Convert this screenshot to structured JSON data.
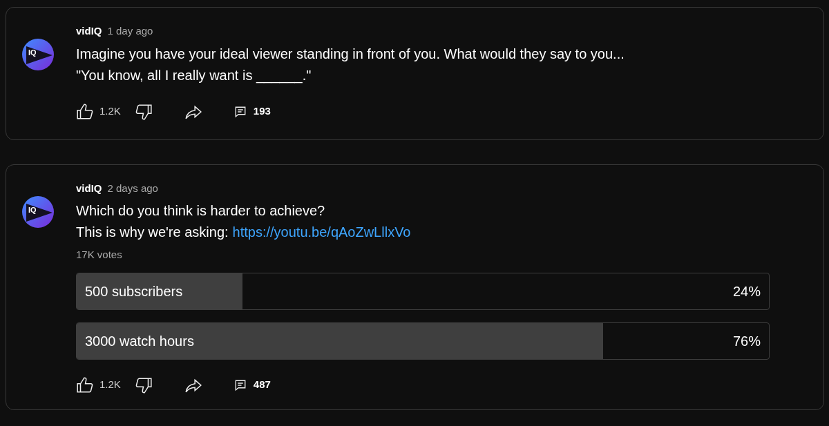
{
  "posts": [
    {
      "kind": "text",
      "avatar_text": "IQ",
      "author": "vidIQ",
      "time": "1 day ago",
      "lines": [
        {
          "text": "Imagine you have your ideal viewer standing in front of you. What would they say to you..."
        },
        {
          "text": "\"You know, all I really want is ______.\""
        }
      ],
      "likes": "1.2K",
      "comments": "193"
    },
    {
      "kind": "poll",
      "avatar_text": "IQ",
      "author": "vidIQ",
      "time": "2 days ago",
      "lines": [
        {
          "text": "Which do you think is harder to achieve?"
        },
        {
          "text": "This is why we're asking:",
          "link": "https://youtu.be/qAoZwLllxVo"
        }
      ],
      "votes": "17K votes",
      "options": [
        {
          "label": "500 subscribers",
          "percent": "24%",
          "level": 0.24
        },
        {
          "label": "3000 watch hours",
          "percent": "76%",
          "level": 0.76
        }
      ],
      "likes": "1.2K",
      "comments": "487"
    }
  ]
}
